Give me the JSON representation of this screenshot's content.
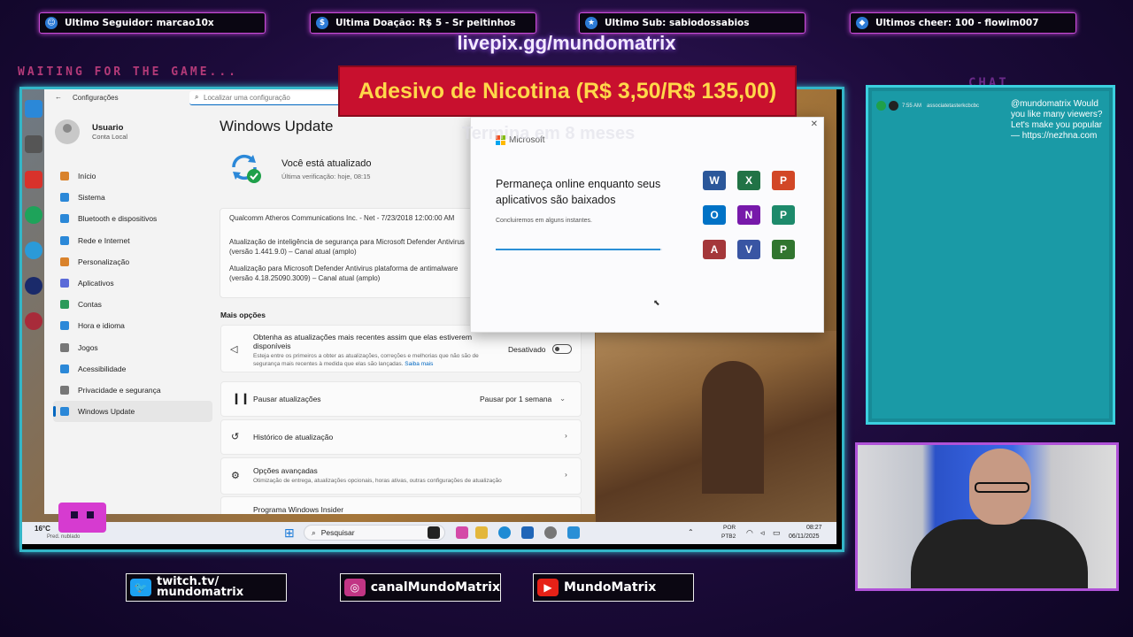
{
  "overlay": {
    "top_bars": [
      {
        "label": "Ultimo Seguidor: marcao10x",
        "icon": "person-icon",
        "color": "#2c7ad6"
      },
      {
        "label": "Ultima Doação: R$ 5 - Sr peitinhos",
        "icon": "dollar-icon",
        "color": "#2c7ad6"
      },
      {
        "label": "Ultimo Sub: sabiodossabios",
        "icon": "star-icon",
        "color": "#2c7ad6"
      },
      {
        "label": "Ultimos cheer: 100 - flowim007",
        "icon": "diamond-icon",
        "color": "#2c7ad6"
      }
    ],
    "livepix": "livepix.gg/mundomatrix",
    "waiting": "WAITING FOR THE GAME...",
    "chat_title": "CHAT",
    "banner": "Adesivo de Nicotina (R$ 3,50/R$ 135,00)",
    "banner_sub": "Termina em 8 meses",
    "socials": [
      {
        "label": "twitch.tv/ mundomatrix",
        "icon": "twitter-icon",
        "color": "#1da1f2"
      },
      {
        "label": "canalMundoMatrix",
        "icon": "instagram-icon",
        "color": "#c13584"
      },
      {
        "label": "MundoMatrix",
        "icon": "youtube-icon",
        "color": "#e62117"
      }
    ]
  },
  "chat": {
    "time": "7:55 AM",
    "user_handle": "associatetasterkcbcbc",
    "text": "@mundomatrix Would you like many viewers? Let's make you popular — https://nezhna.com"
  },
  "settings": {
    "window_title": "Configurações",
    "search_placeholder": "Localizar uma configuração",
    "user": {
      "name": "Usuario",
      "sub": "Conta Local"
    },
    "nav": [
      {
        "label": "Início",
        "icon": "home-icon",
        "color": "#d9822b"
      },
      {
        "label": "Sistema",
        "icon": "monitor-icon",
        "color": "#2b88d8"
      },
      {
        "label": "Bluetooth e dispositivos",
        "icon": "bluetooth-icon",
        "color": "#2b88d8"
      },
      {
        "label": "Rede e Internet",
        "icon": "wifi-icon",
        "color": "#2b88d8"
      },
      {
        "label": "Personalização",
        "icon": "brush-icon",
        "color": "#d9822b"
      },
      {
        "label": "Aplicativos",
        "icon": "apps-icon",
        "color": "#5a6ad8"
      },
      {
        "label": "Contas",
        "icon": "person-icon",
        "color": "#2b9a5a"
      },
      {
        "label": "Hora e idioma",
        "icon": "globe-icon",
        "color": "#2b88d8"
      },
      {
        "label": "Jogos",
        "icon": "gamepad-icon",
        "color": "#777777"
      },
      {
        "label": "Acessibilidade",
        "icon": "accessibility-icon",
        "color": "#2b88d8"
      },
      {
        "label": "Privacidade e segurança",
        "icon": "shield-icon",
        "color": "#777777"
      },
      {
        "label": "Windows Update",
        "icon": "update-icon",
        "color": "#2b88d8"
      }
    ],
    "page_title": "Windows Update",
    "status": "Você está atualizado",
    "last_check": "Última verificação: hoje, 08:15",
    "updates": [
      "Qualcomm Atheros Communications Inc. - Net - 7/23/2018 12:00:00 AM",
      "Atualização de inteligência de segurança para Microsoft Defender Antivirus (versão 1.441.9.0) – Canal atual (amplo)",
      "Atualização para Microsoft Defender Antivirus plataforma de antimalware (versão 4.18.25090.3009) – Canal atual (amplo)"
    ],
    "more_options": "Mais opções",
    "get_latest": {
      "title": "Obtenha as atualizações mais recentes assim que elas estiverem disponíveis",
      "desc": "Esteja entre os primeiros a obter as atualizações, correções e melhorias que não são de segurança mais recentes à medida que elas são lançadas.",
      "link": "Saiba mais",
      "toggle_label": "Desativado"
    },
    "pause": {
      "label": "Pausar atualizações",
      "value": "Pausar por 1 semana"
    },
    "history": "Histórico de atualização",
    "advanced": {
      "title": "Opções avançadas",
      "desc": "Otimização de entrega, atualizações opcionais, horas ativas, outras configurações de atualização"
    },
    "insider": "Programa Windows Insider"
  },
  "ms_dialog": {
    "brand": "Microsoft",
    "heading": "Permaneça online enquanto seus aplicativos são baixados",
    "sub": "Concluiremos em alguns instantes.",
    "progress": 0.99,
    "apps": [
      {
        "letter": "W",
        "color": "#2b579a",
        "icon": "word-icon"
      },
      {
        "letter": "X",
        "color": "#217346",
        "icon": "excel-icon"
      },
      {
        "letter": "P",
        "color": "#d24726",
        "icon": "powerpoint-icon"
      },
      {
        "letter": "O",
        "color": "#0072c6",
        "icon": "outlook-icon"
      },
      {
        "letter": "N",
        "color": "#7719aa",
        "icon": "onenote-icon"
      },
      {
        "letter": "P",
        "color": "#1d8a6b",
        "icon": "planner-icon"
      },
      {
        "letter": "A",
        "color": "#a4373a",
        "icon": "access-icon"
      },
      {
        "letter": "V",
        "color": "#3955a3",
        "icon": "visio-icon"
      },
      {
        "letter": "P",
        "color": "#31752f",
        "icon": "project-icon"
      }
    ]
  },
  "taskbar": {
    "weather": "16°C",
    "weather_sub": "Pred. nublado",
    "search": "Pesquisar",
    "lang": "POR",
    "lang_sub": "PTB2",
    "time": "08:27",
    "date": "06/11/2025"
  }
}
